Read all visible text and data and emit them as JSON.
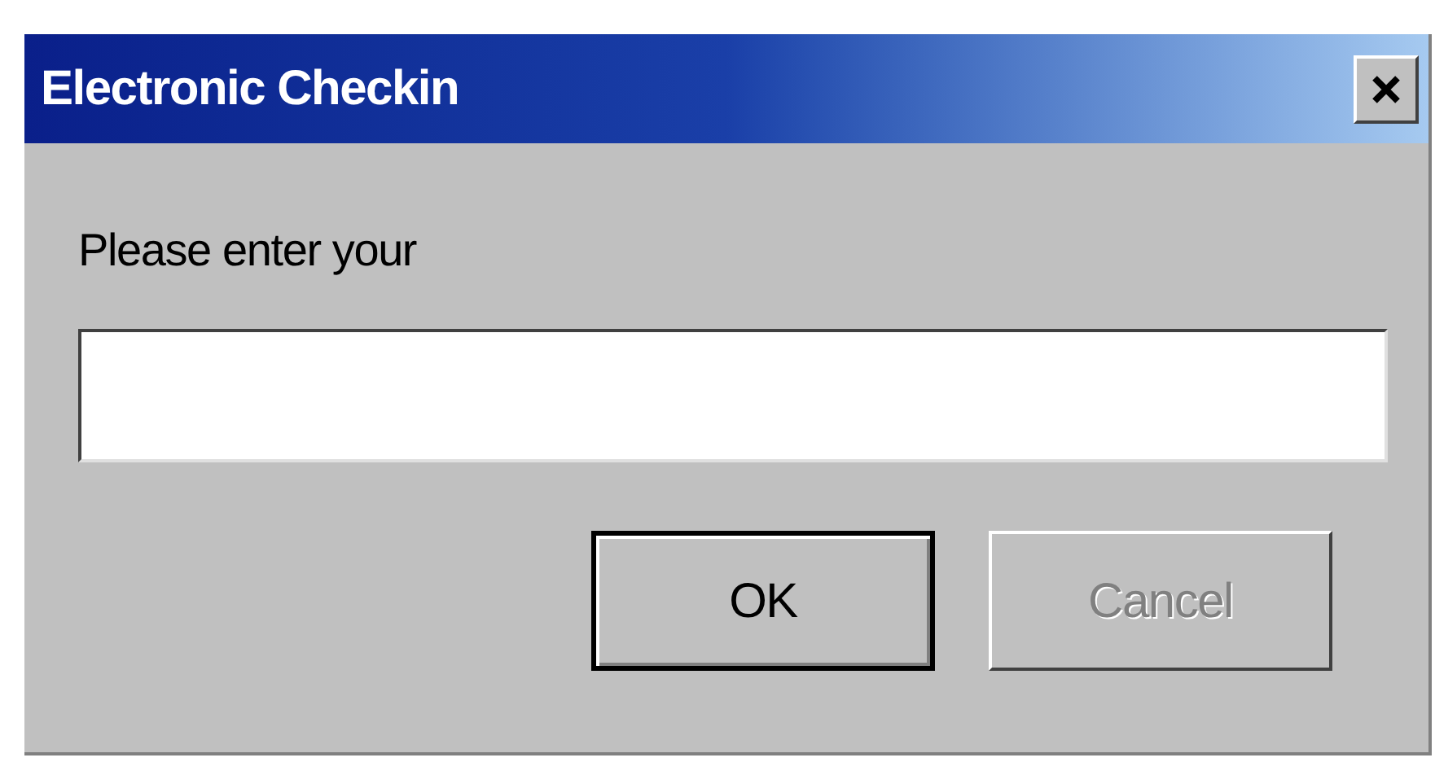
{
  "window": {
    "title": "Electronic Checkin"
  },
  "prompt": {
    "label": "Please enter your"
  },
  "buttons": [
    {
      "label": "OK",
      "default": true,
      "disabled": false
    },
    {
      "label": "Cancel",
      "default": false,
      "disabled": true
    }
  ]
}
